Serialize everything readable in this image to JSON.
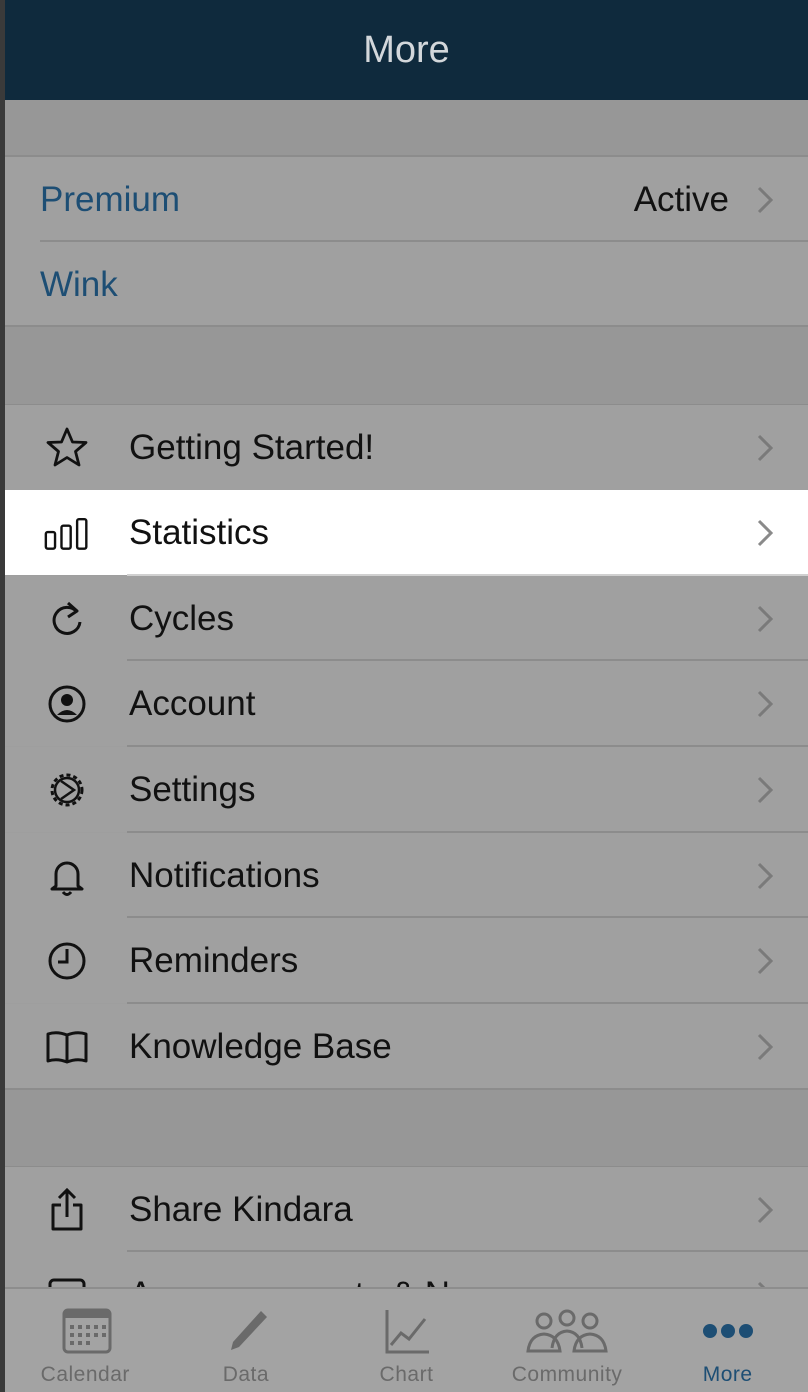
{
  "header": {
    "title": "More"
  },
  "premium_section": {
    "premium_label": "Premium",
    "premium_value": "Active",
    "wink_label": "Wink"
  },
  "menu": {
    "getting_started": "Getting Started!",
    "statistics": "Statistics",
    "cycles": "Cycles",
    "account": "Account",
    "settings": "Settings",
    "notifications": "Notifications",
    "reminders": "Reminders",
    "knowledge_base": "Knowledge Base"
  },
  "share_section": {
    "share": "Share Kindara",
    "partial": "Announcements & N"
  },
  "tabbar": {
    "calendar": "Calendar",
    "data": "Data",
    "chart": "Chart",
    "community": "Community",
    "more": "More"
  },
  "colors": {
    "navbar": "#0f2a3d",
    "accent": "#1d4e74",
    "dimmed_background": "#9e9e9e",
    "highlight": "#ffffff"
  }
}
